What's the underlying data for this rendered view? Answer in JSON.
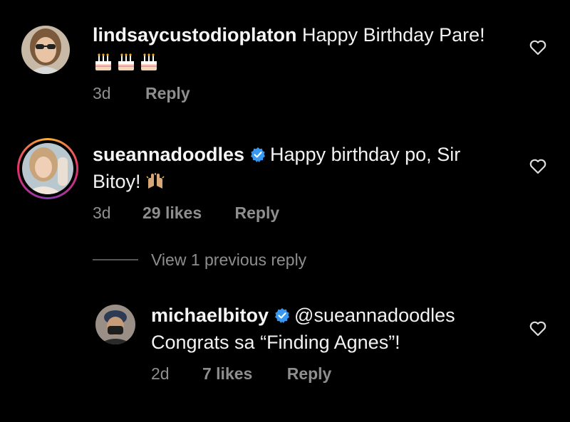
{
  "comments": [
    {
      "username": "lindsaycustodioplaton",
      "verified": false,
      "text_line1": "Happy Birthday Pare!",
      "emoji": [
        "birthday-cake",
        "birthday-cake",
        "birthday-cake"
      ],
      "time": "3d",
      "likes": "",
      "reply_label": "Reply"
    },
    {
      "username": "sueannadoodles",
      "verified": true,
      "text_line1": "Happy birthday po, Sir",
      "text_line2": "Bitoy!",
      "emoji": [
        "raising-hands"
      ],
      "time": "3d",
      "likes": "29 likes",
      "reply_label": "Reply"
    }
  ],
  "view_replies_label": "View 1 previous reply",
  "reply": {
    "username": "michaelbitoy",
    "verified": true,
    "text_line1": "@sueannadoodles",
    "text_line2": "Congrats sa “Finding Agnes”!",
    "time": "2d",
    "likes": "7 likes",
    "reply_label": "Reply"
  },
  "colors": {
    "background": "#000000",
    "text": "#f5f5f5",
    "meta": "#8e8e8e",
    "verified": "#3897f0",
    "story_ring": "#e1306c"
  },
  "icons": [
    "heart-outline-icon",
    "verified-badge-icon"
  ]
}
